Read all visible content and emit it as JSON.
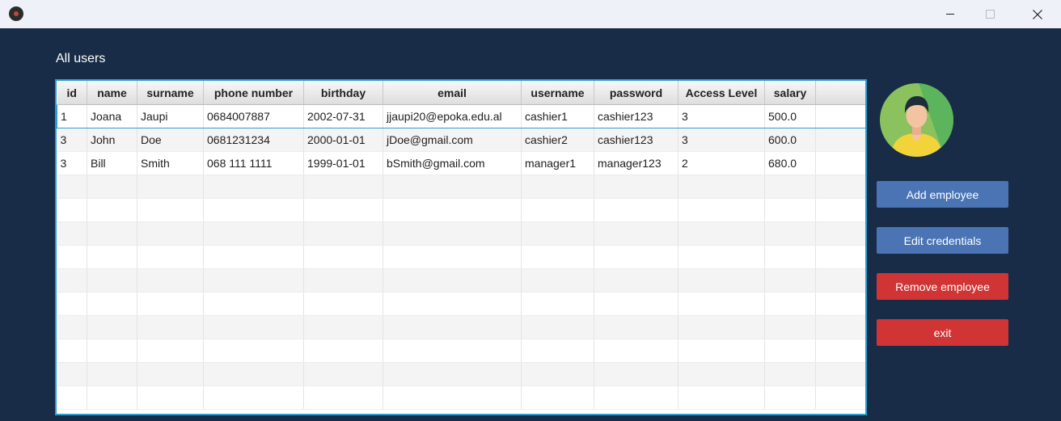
{
  "window": {
    "icon": "app-disc-icon",
    "controls": [
      "minimize-icon",
      "maximize-icon",
      "close-icon"
    ]
  },
  "section_title": "All users",
  "table": {
    "columns": [
      "id",
      "name",
      "surname",
      "phone number",
      "birthday",
      "email",
      "username",
      "password",
      "Access Level",
      "salary",
      ""
    ],
    "rows": [
      [
        "1",
        "Joana",
        "Jaupi",
        "0684007887",
        "2002-07-31",
        "jjaupi20@epoka.edu.al",
        "cashier1",
        "cashier123",
        "3",
        "500.0",
        ""
      ],
      [
        "3",
        "John",
        "Doe",
        "0681231234",
        "2000-01-01",
        "jDoe@gmail.com",
        "cashier2",
        "cashier123",
        "3",
        "600.0",
        ""
      ],
      [
        "3",
        "Bill",
        "Smith",
        "068 111 1111",
        "1999-01-01",
        "bSmith@gmail.com",
        "manager1",
        "manager123",
        "2",
        "680.0",
        ""
      ]
    ],
    "empty_rows": 10,
    "selected_row": 0
  },
  "buttons": {
    "add": "Add employee",
    "edit": "Edit credentials",
    "remove": "Remove employee",
    "exit": "exit"
  },
  "colors": {
    "background": "#182b47",
    "primary_button": "#4a74b4",
    "danger_button": "#d13434",
    "selection": "#2b9fd1"
  }
}
